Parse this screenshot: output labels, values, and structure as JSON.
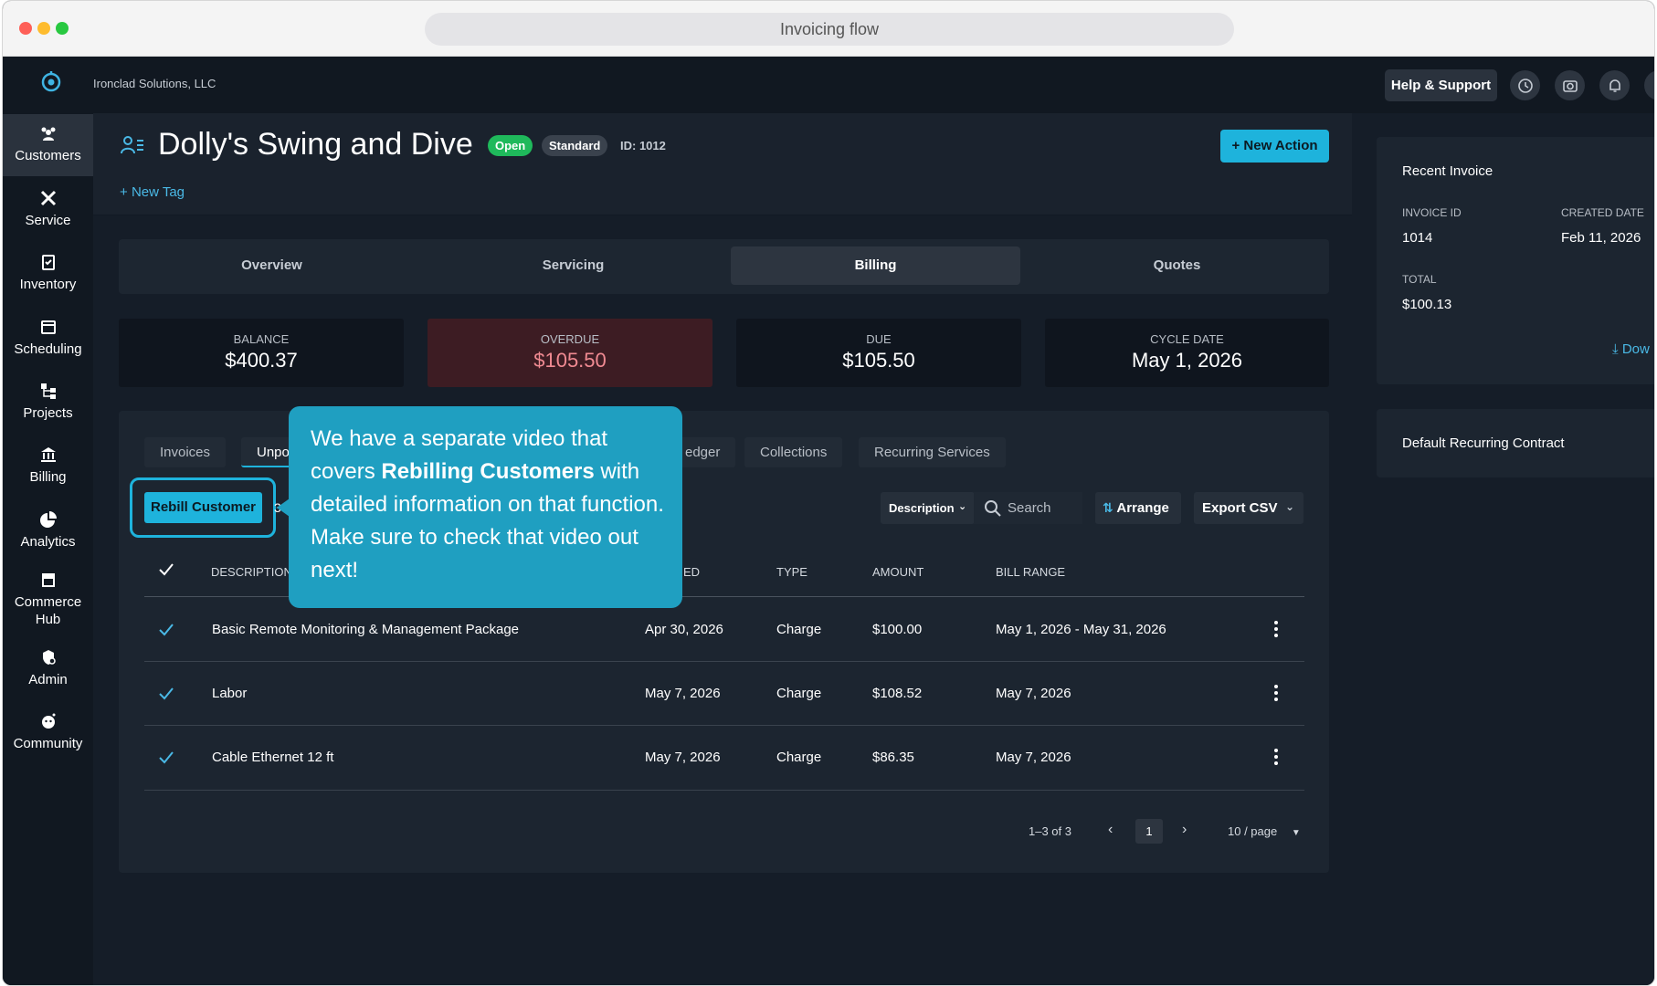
{
  "browser": {
    "url_title": "Invoicing flow"
  },
  "topbar": {
    "company": "Ironclad Solutions, LLC",
    "help_label": "Help & Support"
  },
  "sidebar": {
    "items": [
      {
        "label": "Customers"
      },
      {
        "label": "Service"
      },
      {
        "label": "Inventory"
      },
      {
        "label": "Scheduling"
      },
      {
        "label": "Projects"
      },
      {
        "label": "Billing"
      },
      {
        "label": "Analytics"
      },
      {
        "label": "Commerce Hub"
      },
      {
        "label": "Admin"
      },
      {
        "label": "Community"
      }
    ]
  },
  "header": {
    "title": "Dolly's Swing and Dive",
    "status_badge": "Open",
    "tier_badge": "Standard",
    "id_text": "ID: 1012",
    "new_action": "New Action",
    "new_tag": "New Tag"
  },
  "main_tabs": [
    "Overview",
    "Servicing",
    "Billing",
    "Quotes"
  ],
  "stats": [
    {
      "label": "BALANCE",
      "value": "$400.37"
    },
    {
      "label": "OVERDUE",
      "value": "$105.50"
    },
    {
      "label": "DUE",
      "value": "$105.50"
    },
    {
      "label": "CYCLE DATE",
      "value": "May 1, 2026"
    }
  ],
  "sub_tabs": [
    "Invoices",
    "Unpo",
    "edger",
    "Collections",
    "Recurring Services"
  ],
  "toolbar": {
    "rebill": "Rebill Customer",
    "selected_count": "3",
    "filter_field": "Description",
    "search_placeholder": "Search",
    "arrange": "Arrange",
    "export": "Export CSV"
  },
  "table": {
    "headers": [
      "DESCRIPTION",
      "ED",
      "TYPE",
      "AMOUNT",
      "BILL RANGE"
    ],
    "rows": [
      {
        "description": "Basic Remote Monitoring & Management Package",
        "date": "Apr 30, 2026",
        "type": "Charge",
        "amount": "$100.00",
        "range": "May 1, 2026 - May 31, 2026"
      },
      {
        "description": "Labor",
        "date": "May 7, 2026",
        "type": "Charge",
        "amount": "$108.52",
        "range": "May 7, 2026"
      },
      {
        "description": "Cable Ethernet 12 ft",
        "date": "May 7, 2026",
        "type": "Charge",
        "amount": "$86.35",
        "range": "May 7, 2026"
      }
    ]
  },
  "pagination": {
    "range": "1–3 of 3",
    "page": "1",
    "per_page": "10 / page"
  },
  "right_panel": {
    "recent_title": "Recent Invoice",
    "invoice_id_label": "INVOICE ID",
    "invoice_id": "1014",
    "created_label": "CREATED DATE",
    "created": "Feb 11, 2026",
    "total_label": "TOTAL",
    "total": "$100.13",
    "download": "Dow",
    "contract_title": "Default Recurring Contract"
  },
  "callout": {
    "text_before": "We have a separate video that covers ",
    "text_bold": "Rebilling Customers",
    "text_after": " with detailed information on that function. Make sure to check that video out next!"
  },
  "colors": {
    "accent": "#1eb3dc",
    "overdue_bg": "#3d1c23",
    "overdue_text": "#f08a92",
    "open_badge": "#1fb95b"
  }
}
